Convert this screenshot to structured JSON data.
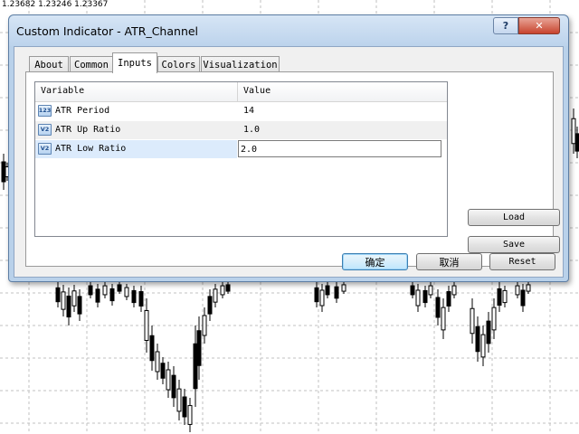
{
  "chart": {
    "price_readout": "1.23682 1.23246 1.23367",
    "background_color": "#ffffff",
    "grid_color": "#c0c0c0",
    "candle_color": "#000000"
  },
  "dialog": {
    "title": "Custom Indicator - ATR_Channel",
    "help_glyph": "?",
    "close_glyph": "✕",
    "tabs": [
      {
        "label": "About",
        "active": false
      },
      {
        "label": "Common",
        "active": false
      },
      {
        "label": "Inputs",
        "active": true
      },
      {
        "label": "Colors",
        "active": false
      },
      {
        "label": "Visualization",
        "active": false
      }
    ],
    "inputs_table": {
      "headers": {
        "variable": "Variable",
        "value": "Value"
      },
      "rows": [
        {
          "icon": "int-type-icon",
          "icon_text": "123",
          "variable": "ATR Period",
          "value": "14"
        },
        {
          "icon": "double-type-icon",
          "icon_text": "V2",
          "variable": "ATR Up Ratio",
          "value": "1.0"
        },
        {
          "icon": "double-type-icon",
          "icon_text": "V2",
          "variable": "ATR Low Ratio",
          "value": "2.0",
          "editing": true
        }
      ]
    },
    "side_buttons": {
      "load": "Load",
      "save": "Save"
    },
    "footer_buttons": {
      "ok": "确定",
      "cancel": "取消",
      "reset": "Reset"
    }
  }
}
